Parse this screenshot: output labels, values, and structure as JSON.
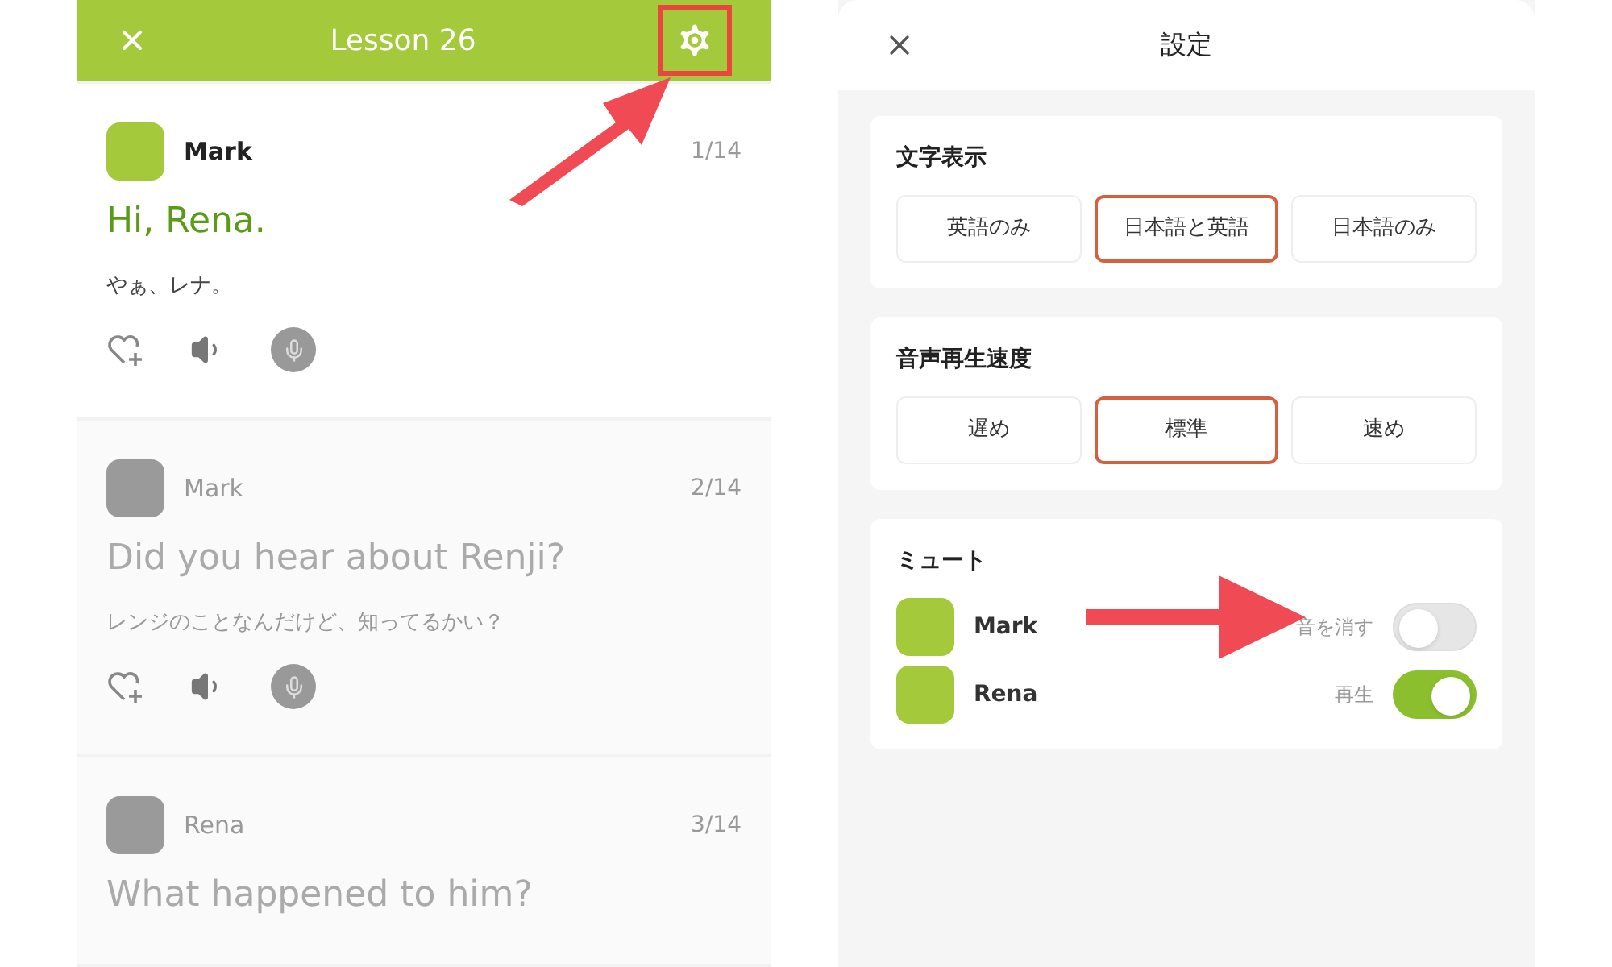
{
  "lesson_screen": {
    "title": "Lesson 26",
    "settings_highlighted": true,
    "messages": [
      {
        "speaker": "Mark",
        "counter": "1/14",
        "english": "Hi, Rena.",
        "japanese": "やぁ、レナ。",
        "active": true
      },
      {
        "speaker": "Mark",
        "counter": "2/14",
        "english": "Did you hear about Renji?",
        "japanese": "レンジのことなんだけど、知ってるかい？",
        "active": false
      },
      {
        "speaker": "Rena",
        "counter": "3/14",
        "english": "What happened to him?",
        "active": false
      }
    ]
  },
  "settings_screen": {
    "title": "設定",
    "sections": [
      {
        "kind": "options",
        "heading": "文字表示",
        "options": [
          {
            "label": "英語のみ",
            "selected": false
          },
          {
            "label": "日本語と英語",
            "selected": true
          },
          {
            "label": "日本語のみ",
            "selected": false
          }
        ]
      },
      {
        "kind": "options",
        "heading": "音声再生速度",
        "options": [
          {
            "label": "遅め",
            "selected": false
          },
          {
            "label": "標準",
            "selected": true
          },
          {
            "label": "速め",
            "selected": false
          }
        ]
      },
      {
        "kind": "mute",
        "heading": "ミュート",
        "speakers": [
          {
            "name": "Mark",
            "status": "音を消す",
            "on": false
          },
          {
            "name": "Rena",
            "status": "再生",
            "on": true
          }
        ]
      }
    ]
  }
}
